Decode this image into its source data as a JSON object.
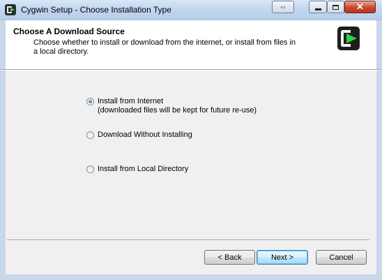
{
  "window": {
    "title": "Cygwin Setup - Choose Installation Type",
    "controls": {
      "swap": "⇔",
      "close": "✕"
    }
  },
  "header": {
    "title": "Choose A Download Source",
    "description": "Choose whether to install or download from the internet, or install from files in a local directory."
  },
  "options": [
    {
      "label": "Install from Internet",
      "sublabel": "(downloaded files will be kept for future re-use)",
      "checked": true
    },
    {
      "label": "Download Without Installing",
      "checked": false
    },
    {
      "label": "Install from Local Directory",
      "checked": false
    }
  ],
  "buttons": {
    "back": "< Back",
    "next": "Next >",
    "cancel": "Cancel"
  },
  "colors": {
    "frame": "#c8d7ea",
    "body": "#f0f0f0",
    "logo_green": "#2fd23f",
    "close_red": "#c9462d"
  },
  "icons": {
    "app": "cygwin-icon",
    "logo": "cygwin-logo-icon"
  }
}
